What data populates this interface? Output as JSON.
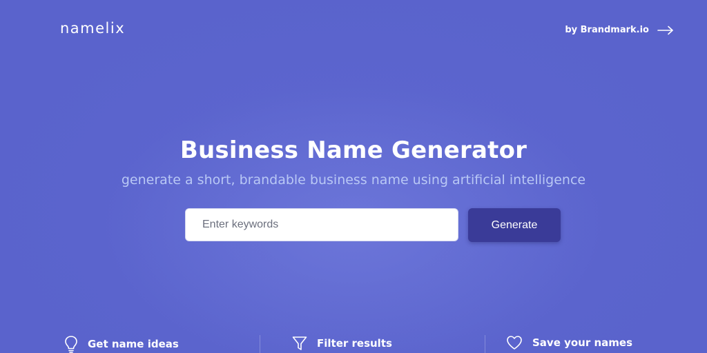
{
  "header": {
    "logo": "namelix",
    "by_link_label": "by Brandmark.io"
  },
  "hero": {
    "title": "Business Name Generator",
    "subtitle": "generate a short, brandable business name using artificial intelligence"
  },
  "search": {
    "placeholder": "Enter keywords",
    "value": "",
    "button_label": "Generate"
  },
  "features": [
    {
      "label": "Get name ideas",
      "icon": "lightbulb-icon"
    },
    {
      "label": "Filter results",
      "icon": "filter-icon"
    },
    {
      "label": "Save your names",
      "icon": "heart-icon"
    }
  ],
  "colors": {
    "background": "#5a63cc",
    "button": "#3a3b98",
    "subtitle": "#b9c8f5"
  }
}
